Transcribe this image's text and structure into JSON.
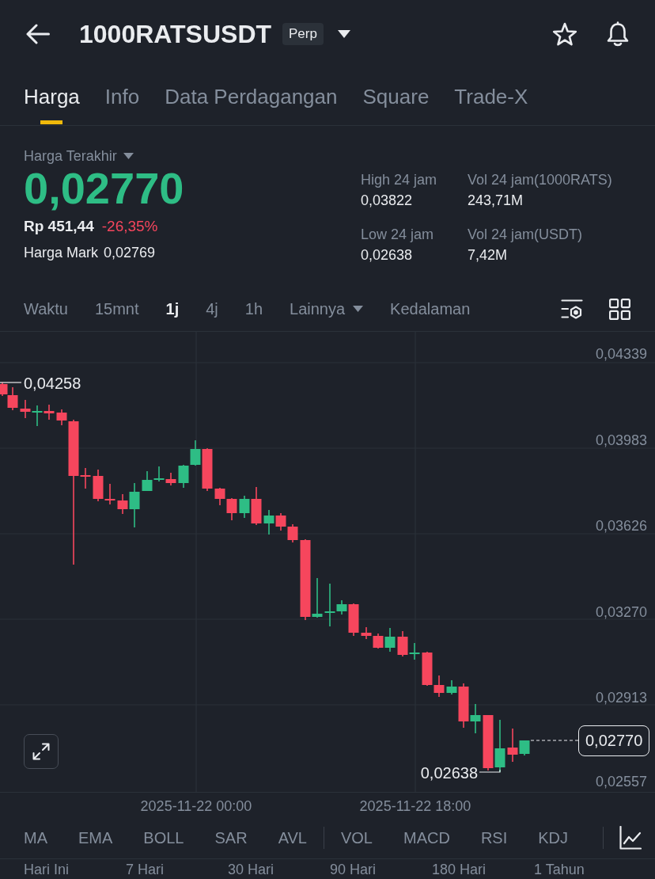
{
  "header": {
    "symbol": "1000RATSUSDT",
    "badge": "Perp"
  },
  "tabs": [
    {
      "label": "Harga",
      "selected": true
    },
    {
      "label": "Info",
      "selected": false
    },
    {
      "label": "Data Perdagangan",
      "selected": false
    },
    {
      "label": "Square",
      "selected": false
    },
    {
      "label": "Trade-X",
      "selected": false
    }
  ],
  "summary": {
    "last_price_label": "Harga Terakhir",
    "last_price": "0,02770",
    "last_price_rising": true,
    "fiat_price": "Rp 451,44",
    "change": "-26,35%",
    "change_rising": false,
    "mark_label": "Harga Mark",
    "mark_price": "0,02769"
  },
  "stats": [
    {
      "label": "High 24 jam",
      "value": "0,03822"
    },
    {
      "label": "Vol 24 jam(1000RATS)",
      "value": "243,71M"
    },
    {
      "label": "Low 24 jam",
      "value": "0,02638"
    },
    {
      "label": "Vol 24 jam(USDT)",
      "value": "7,42M"
    }
  ],
  "intervals": [
    {
      "label": "Waktu",
      "kind": "option",
      "selected": false
    },
    {
      "label": "15mnt",
      "kind": "option",
      "selected": false
    },
    {
      "label": "1j",
      "kind": "option",
      "selected": true
    },
    {
      "label": "4j",
      "kind": "option",
      "selected": false
    },
    {
      "label": "1h",
      "kind": "option",
      "selected": false
    },
    {
      "label": "Lainnya",
      "kind": "menu",
      "selected": false
    },
    {
      "label": "Kedalaman",
      "kind": "option",
      "selected": false
    }
  ],
  "chart": {
    "y_labels": [
      "0,04339",
      "0,03983",
      "0,03626",
      "0,03270",
      "0,02913",
      "0,02557"
    ],
    "high_label": "0,04258",
    "low_label": "0,02638",
    "last_price": "0,02770",
    "x_labels": [
      "2025-11-22 00:00",
      "2025-11-22 18:00"
    ]
  },
  "main_indicators": [
    "MA",
    "EMA",
    "BOLL",
    "SAR",
    "AVL"
  ],
  "sub_indicators": [
    "VOL",
    "MACD",
    "RSI",
    "KDJ"
  ],
  "ranges": [
    "Hari Ini",
    "7 Hari",
    "30 Hari",
    "90 Hari",
    "180 Hari",
    "1 Tahun"
  ]
}
